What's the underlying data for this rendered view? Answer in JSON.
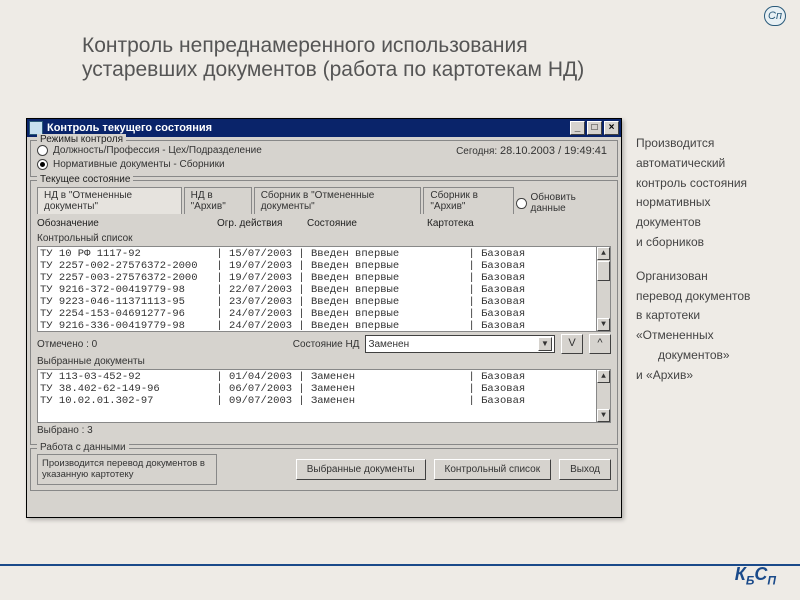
{
  "page": {
    "title": "Контроль непреднамеренного использования устаревших документов (работа по картотекам НД)"
  },
  "logo_glyph": "Сп",
  "right_text": {
    "l1": "Производится",
    "l2": "автоматический",
    "l3": "контроль состояния",
    "l4": "нормативных",
    "l5": "документов",
    "l6": "и сборников",
    "l7": "Организован",
    "l8": "перевод документов",
    "l9": "в картотеки",
    "l10": "«Отмененных",
    "l10b": "документов»",
    "l11": "и   «Архив»"
  },
  "footer": {
    "k": "К",
    "b": "Б",
    "s": "С",
    "p": "П"
  },
  "win": {
    "title": "Контроль текущего состояния",
    "min": "_",
    "max": "□",
    "close": "×",
    "modes_label": "Режимы контроля",
    "radio1": "Должность/Профессия - Цех/Подразделение",
    "radio2": "Нормативные документы - Сборники",
    "today_label": "Сегодня:",
    "today_value": "28.10.2003 / 19:49:41",
    "state_label": "Текущее состояние",
    "tabs": {
      "t1": "НД в \"Отмененные документы\"",
      "t2": "НД в \"Архив\"",
      "t3": "Сборник в \"Отмененные документы\"",
      "t4": "Сборник в \"Архив\""
    },
    "refresh": "Обновить данные",
    "cols": {
      "c1": "Обозначение",
      "c2": "Огр. действия",
      "c3": "Состояние",
      "c4": "Картотека"
    },
    "list1_label": "Контрольный список",
    "list1": [
      "ТУ 10 РФ 1117-92            | 15/07/2003 | Введен впервые           | Базовая",
      "ТУ 2257-002-27576372-2000   | 19/07/2003 | Введен впервые           | Базовая",
      "ТУ 2257-003-27576372-2000   | 19/07/2003 | Введен впервые           | Базовая",
      "ТУ 9216-372-00419779-98     | 22/07/2003 | Введен впервые           | Базовая",
      "ТУ 9223-046-11371113-95     | 23/07/2003 | Введен впервые           | Базовая",
      "ТУ 2254-153-04691277-96     | 24/07/2003 | Введен впервые           | Базовая",
      "ТУ 9216-336-00419779-98     | 24/07/2003 | Введен впервые           | Базовая"
    ],
    "marked_label": "Отмечено : 0",
    "state_nd_label": "Состояние НД",
    "state_nd_value": "Заменен",
    "btn_v": "V",
    "btn_up": "^",
    "list2_label": "Выбранные документы",
    "list2": [
      "ТУ 113-03-452-92            | 01/04/2003 | Заменен                  | Базовая",
      "ТУ 38.402-62-149-96         | 06/07/2003 | Заменен                  | Базовая",
      "ТУ 10.02.01.302-97          | 09/07/2003 | Заменен                  | Базовая"
    ],
    "selected_label": "Выбрано : 3",
    "work_label": "Работа с данными",
    "hint": "Производится перевод документов в указанную картотеку",
    "btn_sel": "Выбранные документы",
    "btn_ctrl": "Контрольный список",
    "btn_exit": "Выход"
  }
}
